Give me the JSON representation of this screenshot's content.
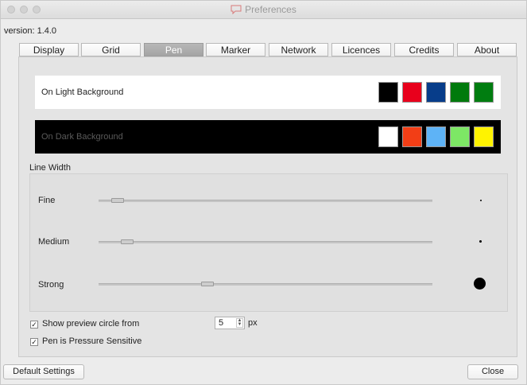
{
  "window": {
    "title": "Preferences",
    "version_text": "version: 1.4.0"
  },
  "tabs": [
    {
      "label": "Display"
    },
    {
      "label": "Grid"
    },
    {
      "label": "Pen"
    },
    {
      "label": "Marker"
    },
    {
      "label": "Network"
    },
    {
      "label": "Licences"
    },
    {
      "label": "Credits"
    },
    {
      "label": "About"
    }
  ],
  "active_tab": "Pen",
  "light_background": {
    "label": "On Light Background",
    "colors": [
      "#000000",
      "#e8001c",
      "#073d8a",
      "#007a0c",
      "#007d10"
    ]
  },
  "dark_background": {
    "label": "On Dark Background",
    "colors": [
      "#ffffff",
      "#f23e16",
      "#5eb3f6",
      "#7de765",
      "#fff300"
    ]
  },
  "line_width": {
    "title": "Line Width",
    "rows": [
      {
        "label": "Fine",
        "level": 0.04,
        "preview": "small-dot"
      },
      {
        "label": "Medium",
        "level": 0.07,
        "preview": "medium-dot"
      },
      {
        "label": "Strong",
        "level": 0.32,
        "preview": "large-dot"
      }
    ]
  },
  "options": {
    "preview_label": "Show preview circle from",
    "preview_checked": true,
    "preview_value": "5",
    "preview_unit": "px",
    "pressure_label": "Pen is Pressure Sensitive",
    "pressure_checked": true
  },
  "buttons": {
    "default_settings": "Default Settings",
    "close": "Close"
  }
}
